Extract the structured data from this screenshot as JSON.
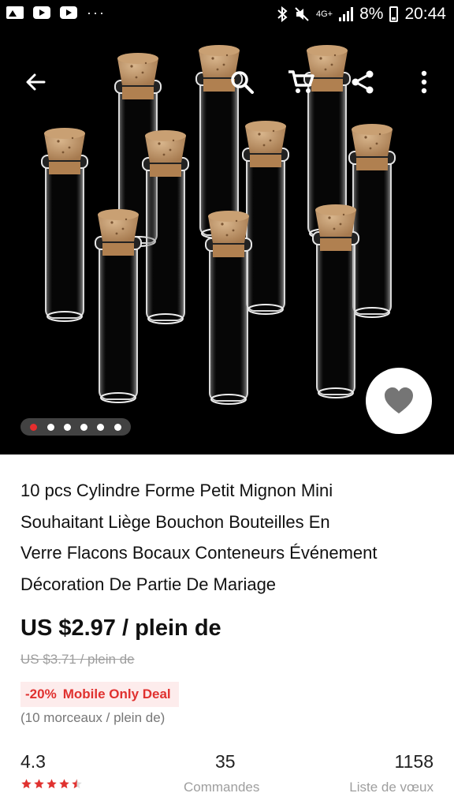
{
  "status_bar": {
    "time": "20:44",
    "battery": "8%",
    "network": "4G+",
    "more": "···"
  },
  "toolbar": {
    "back_icon": "arrow-left-icon",
    "search_icon": "search-icon",
    "cart_icon": "cart-icon",
    "share_icon": "share-icon",
    "menu_icon": "more-vert-icon"
  },
  "gallery": {
    "total_images": 6,
    "active_index": 0,
    "wishlist_icon": "heart-icon"
  },
  "product": {
    "title_lines": [
      "10 pcs Cylindre Forme Petit Mignon Mini",
      "Souhaitant Liège Bouchon Bouteilles En",
      "Verre Flacons Bocaux Conteneurs Événement",
      "Décoration De Partie De Mariage"
    ],
    "price": "US $2.97 / plein de",
    "original_price": "US $3.71 / plein de",
    "discount": "-20%",
    "deal_label": "Mobile Only Deal",
    "unit_info": "(10 morceaux / plein de)"
  },
  "stats": {
    "rating": "4.3",
    "rating_stars": 4.5,
    "orders_count": "35",
    "orders_label": "Commandes",
    "wishlist_count": "1158",
    "wishlist_label": "Liste de vœux"
  },
  "colors": {
    "accent": "#e0312f",
    "deal_bg": "#fdecec",
    "muted": "#9e9e9e"
  }
}
